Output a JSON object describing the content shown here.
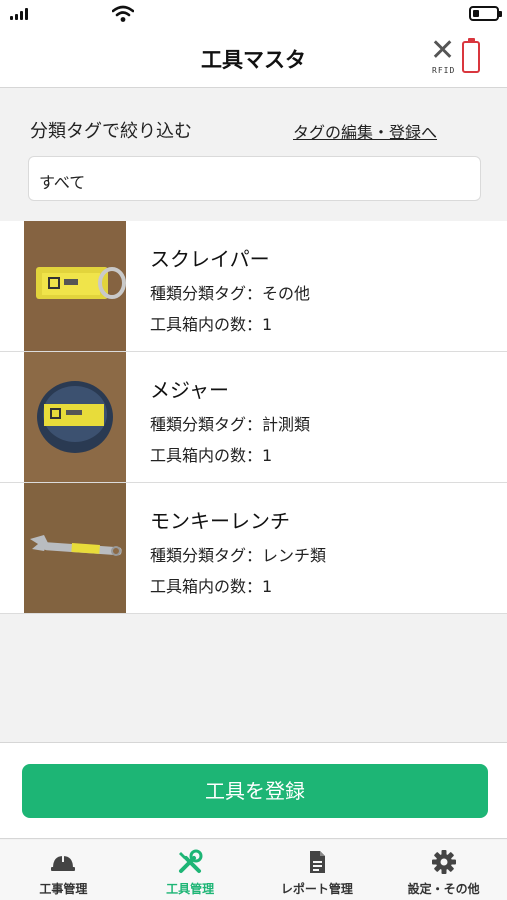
{
  "header": {
    "title": "工具マスタ",
    "rfid_label": "RFID"
  },
  "filter": {
    "label": "分類タグで絞り込む",
    "edit_link": "タグの編集・登録へ",
    "selected": "すべて"
  },
  "tools": [
    {
      "name": "スクレイパー",
      "tag": "種類分類タグ：その他",
      "count": "工具箱内の数：1"
    },
    {
      "name": "メジャー",
      "tag": "種類分類タグ：計測類",
      "count": "工具箱内の数：1"
    },
    {
      "name": "モンキーレンチ",
      "tag": "種類分類タグ：レンチ類",
      "count": "工具箱内の数：1"
    }
  ],
  "register_button": "工具を登録",
  "tabs": [
    {
      "label": "工事管理",
      "icon": "helmet-icon"
    },
    {
      "label": "工具管理",
      "icon": "tools-icon"
    },
    {
      "label": "レポート管理",
      "icon": "document-icon"
    },
    {
      "label": "設定・その他",
      "icon": "gear-icon"
    }
  ],
  "colors": {
    "accent": "#1db575",
    "rfid_battery": "#d9363e"
  }
}
